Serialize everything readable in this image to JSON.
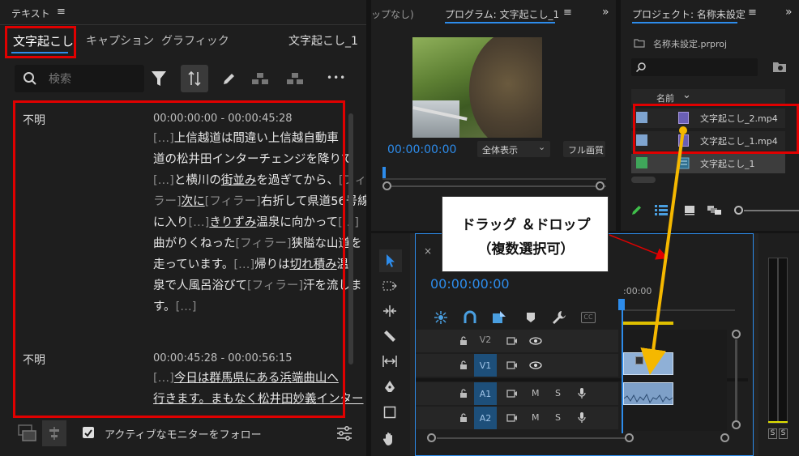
{
  "text_panel": {
    "title": "テキスト",
    "menu_glyph": "≡",
    "tabs": [
      {
        "label": "文字起こし",
        "active": true
      },
      {
        "label": "キャプション",
        "active": false
      },
      {
        "label": "グラフィック",
        "active": false
      }
    ],
    "sequence_name": "文字起こし_1",
    "search_placeholder": "検索",
    "more_glyph": "•••",
    "blocks": [
      {
        "speaker": "不明",
        "timecode": "00:00:00:00 - 00:00:45:28",
        "lines": [
          [
            {
              "t": "[…]",
              "f": true
            },
            {
              "t": "上信越道は間違い上信越自動車"
            }
          ],
          [
            {
              "t": "道の松井田インターチェンジを降りて"
            }
          ],
          [
            {
              "t": "[…]",
              "f": true
            },
            {
              "t": "と横川の"
            },
            {
              "t": "街並み",
              "u": true
            },
            {
              "t": "を過ぎてから、"
            },
            {
              "t": "[フィー",
              "f": true
            }
          ],
          [
            {
              "t": "ラー]",
              "f": true
            },
            {
              "t": "次に",
              "u": true
            },
            {
              "t": "[フィラー]",
              "f": true
            },
            {
              "t": "右折して県道56号線"
            }
          ],
          [
            {
              "t": "に入り"
            },
            {
              "t": "[…]",
              "f": true
            },
            {
              "t": "きりずみ",
              "u": true
            },
            {
              "t": "温泉に向かって"
            },
            {
              "t": "[…]",
              "f": true
            }
          ],
          [
            {
              "t": "曲がりくねった"
            },
            {
              "t": "[フィラー]",
              "f": true
            },
            {
              "t": "狭隘な山道を"
            }
          ],
          [
            {
              "t": "走っています。"
            },
            {
              "t": "[…]",
              "f": true
            },
            {
              "t": "帰りは"
            },
            {
              "t": "切れ積み",
              "u": true
            },
            {
              "t": "温"
            }
          ],
          [
            {
              "t": "泉で人風呂浴びて"
            },
            {
              "t": "[フィラー]",
              "f": true
            },
            {
              "t": "汗を流しま"
            }
          ],
          [
            {
              "t": "す。"
            },
            {
              "t": "[…]",
              "f": true
            }
          ]
        ]
      },
      {
        "speaker": "不明",
        "timecode": "00:00:45:28 - 00:00:56:15",
        "lines": [
          [
            {
              "t": "[…]",
              "f": true
            },
            {
              "t": "今日は群馬県にある浜端曲山へ",
              "u": true
            }
          ],
          [
            {
              "t": "行きます。まもなく松井田妙義インター",
              "u": true
            }
          ]
        ]
      }
    ],
    "follow_label": "アクティブなモニターをフォロー",
    "follow_checked": true
  },
  "source_panel": {
    "title_partial": "ップなし)"
  },
  "program_panel": {
    "title": "プログラム: 文字起こし_1",
    "menu_glyph": "≡",
    "timecode": "00:00:00:00",
    "zoom": "全体表示",
    "quality": "フル画質"
  },
  "project_panel": {
    "title": "プロジェクト: 名称未設定",
    "menu_glyph": "≡",
    "file": "名称未設定.prproj",
    "column_name": "名前",
    "items": [
      {
        "name": "文字起こし_2.mp4",
        "swatch": "#7fa4cf"
      },
      {
        "name": "文字起こし_1.mp4",
        "swatch": "#7fa4cf"
      },
      {
        "name": "文字起こし_1",
        "swatch": "#3fa65a"
      }
    ]
  },
  "timeline": {
    "close_glyph": "×",
    "timecode": "00:00:00:00",
    "ruler_label": ":00:00",
    "tracks": [
      {
        "name": "V2",
        "type": "video"
      },
      {
        "name": "V1",
        "type": "video"
      },
      {
        "name": "A1",
        "type": "audio"
      },
      {
        "name": "A2",
        "type": "audio"
      }
    ],
    "mute_label": "M",
    "solo_label": "S"
  },
  "meter": {
    "labels": [
      "S",
      "S"
    ]
  },
  "callout": {
    "line1": "ドラッグ ＆ドロップ",
    "line2": "（複数選択可）"
  },
  "colors": {
    "accent_blue": "#2d8ceb",
    "red_highlight": "#e00000",
    "arrow_yellow": "#f5b800"
  }
}
